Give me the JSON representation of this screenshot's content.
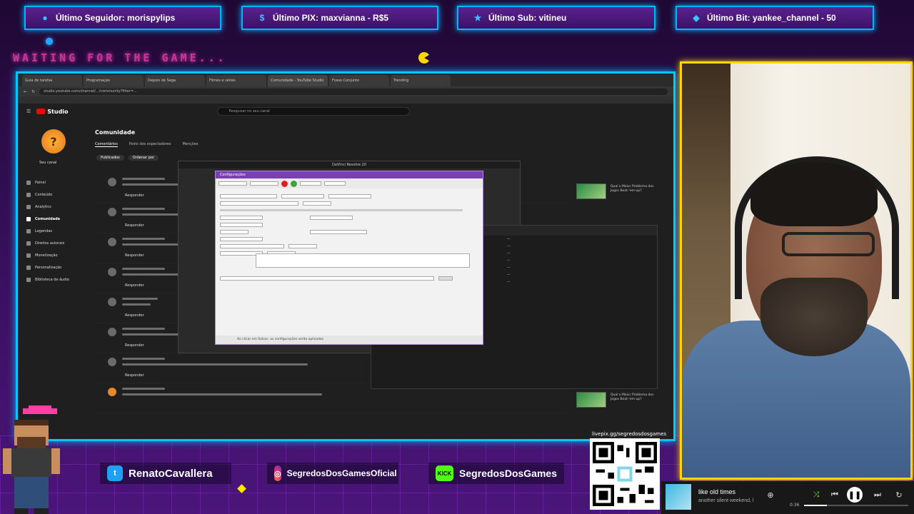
{
  "top_bars": [
    {
      "icon": "user-icon",
      "text": "Último Seguidor: morispylips"
    },
    {
      "icon": "dollar-icon",
      "text": "Último PIX: maxvianna - R$5"
    },
    {
      "icon": "star-icon",
      "text": "Último Sub: vitineu"
    },
    {
      "icon": "diamond-icon",
      "text": "Último Bit: yankee_channel - 50"
    }
  ],
  "waiting_text": "WAITING FOR THE GAME...",
  "browser": {
    "tabs": [
      "Guia de tarefas",
      "Programação",
      "Depois de Sega",
      "Filmes e séries",
      "Comunidade - YouTube Studio",
      "Fosso Conjunto",
      "Trending"
    ],
    "url": "studio.youtube.com/channel/.../community?filter=...",
    "yt_studio_label": "Studio",
    "search_placeholder": "Pesquisar no seu canal",
    "channel_name": "Seu canal",
    "side_menu": [
      "Painel",
      "Conteúdo",
      "Analytics",
      "Comunidade",
      "Legendas",
      "Direitos autorais",
      "Monetização",
      "Personalização",
      "Biblioteca de áudio"
    ],
    "page_title": "Comunidade",
    "subtabs": [
      "Comentários",
      "Posts dos espectadores",
      "Menções"
    ],
    "filter_label": "Publicados",
    "sort_label": "Ordenar por",
    "reply_label": "Responder",
    "davinci_title": "DaVinci Resolve 20",
    "dialog_title": "Configurações",
    "dialog_footer": "Ao clicar em Salvar, as configurações serão aplicadas"
  },
  "right_thumbs": [
    {
      "text": "Qual o Maior Problema dos Jogos Beat-'em-up?"
    },
    {
      "text": "Qual o Maior Problema dos Jogos Beat-'em-up?"
    }
  ],
  "socials": [
    {
      "icon": "twitter-icon",
      "handle": "RenatoCavallera"
    },
    {
      "icon": "instagram-icon",
      "handle": "SegredosDosGamesOficial"
    },
    {
      "icon": "kick-icon",
      "logo_text": "KICK",
      "handle": "SegredosDosGames"
    }
  ],
  "qr_label": "livepix.gg/segredosdosgames",
  "player": {
    "title": "like old times",
    "artist": "another silent weekend, l",
    "time": "0:36",
    "progress": 0.22
  },
  "colors": {
    "accent_blue": "#00c8ff",
    "accent_yellow": "#ffd600",
    "bg_purple": "#3a1060",
    "waiting_pink": "#c7349d"
  }
}
